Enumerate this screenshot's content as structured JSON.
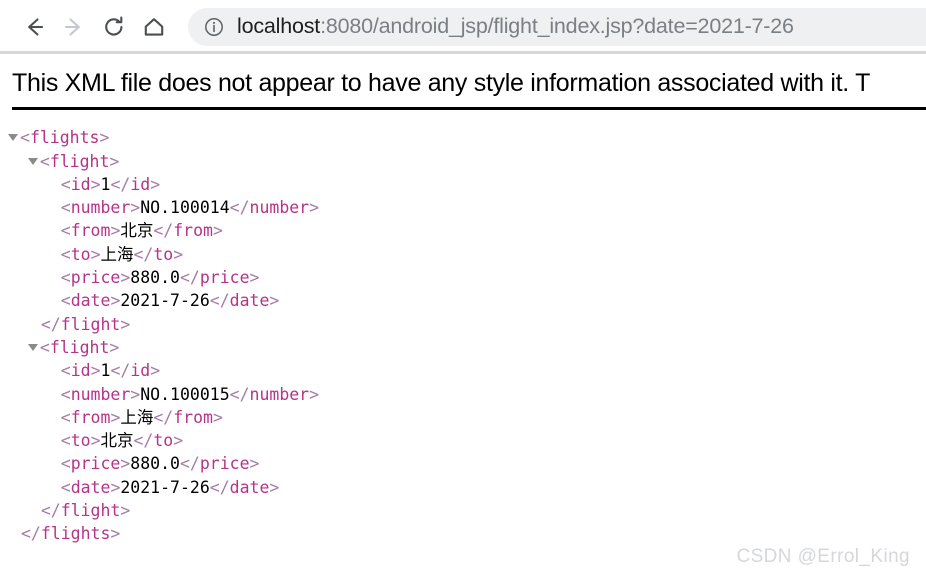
{
  "browser": {
    "back_label": "Back",
    "forward_label": "Forward",
    "reload_label": "Reload",
    "home_label": "Home",
    "site_info_label": "View site information",
    "url_host": "localhost",
    "url_rest": ":8080/android_jsp/flight_index.jsp?date=2021-7-26",
    "url_full": "localhost:8080/android_jsp/flight_index.jsp?date=2021-7-26"
  },
  "notice": {
    "text": "This XML file does not appear to have any style information associated with it. T"
  },
  "xml": {
    "lines": [
      {
        "indent": 0,
        "twisty": true,
        "open": "flights"
      },
      {
        "indent": 1,
        "twisty": true,
        "open": "flight"
      },
      {
        "indent": 2,
        "twisty": false,
        "tag": "id",
        "value": "1"
      },
      {
        "indent": 2,
        "twisty": false,
        "tag": "number",
        "value": "NO.100014"
      },
      {
        "indent": 2,
        "twisty": false,
        "tag": "from",
        "value": "北京"
      },
      {
        "indent": 2,
        "twisty": false,
        "tag": "to",
        "value": "上海"
      },
      {
        "indent": 2,
        "twisty": false,
        "tag": "price",
        "value": "880.0"
      },
      {
        "indent": 2,
        "twisty": false,
        "tag": "date",
        "value": "2021-7-26"
      },
      {
        "indent": 1,
        "twisty": false,
        "close": "flight"
      },
      {
        "indent": 1,
        "twisty": true,
        "open": "flight"
      },
      {
        "indent": 2,
        "twisty": false,
        "tag": "id",
        "value": "1"
      },
      {
        "indent": 2,
        "twisty": false,
        "tag": "number",
        "value": "NO.100015"
      },
      {
        "indent": 2,
        "twisty": false,
        "tag": "from",
        "value": "上海"
      },
      {
        "indent": 2,
        "twisty": false,
        "tag": "to",
        "value": "北京"
      },
      {
        "indent": 2,
        "twisty": false,
        "tag": "price",
        "value": "880.0"
      },
      {
        "indent": 2,
        "twisty": false,
        "tag": "date",
        "value": "2021-7-26"
      },
      {
        "indent": 1,
        "twisty": false,
        "close": "flight"
      },
      {
        "indent": 0,
        "twisty": false,
        "close": "flights"
      }
    ]
  },
  "watermark": {
    "text": "CSDN @Errol_King"
  },
  "colors": {
    "tag_name": "#b5338a",
    "bracket": "#a57ca5",
    "value": "#000000",
    "omnibox_bg": "#eff0f1",
    "url_host": "#1f1f1f",
    "url_rest": "#7a7f85",
    "watermark": "#d5d7da"
  }
}
